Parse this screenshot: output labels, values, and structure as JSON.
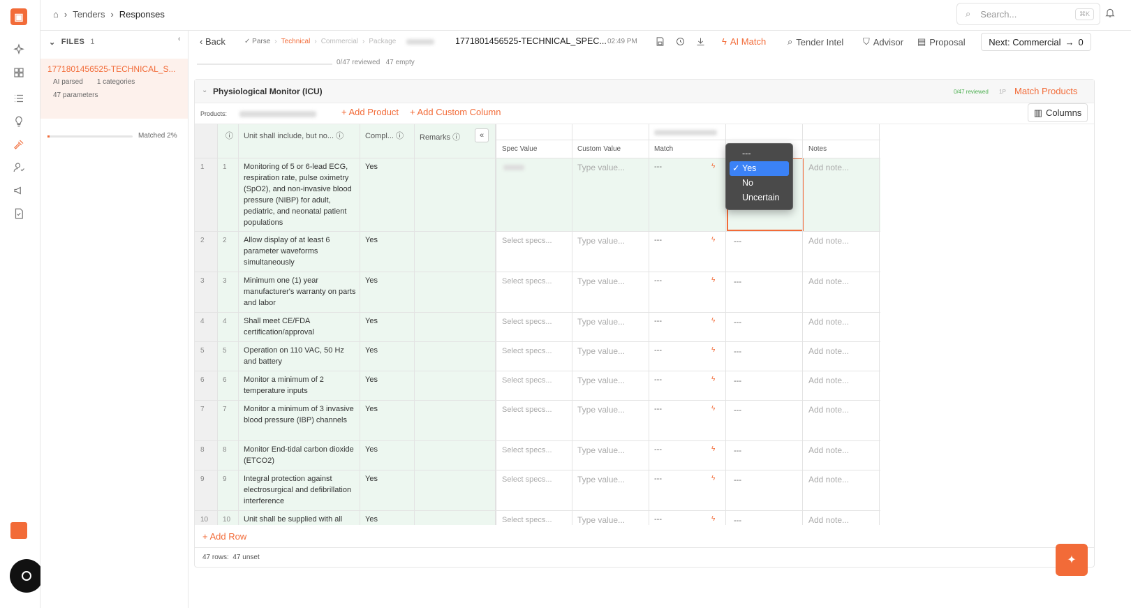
{
  "breadcrumb": {
    "item1": "Tenders",
    "item2": "Responses"
  },
  "search": {
    "placeholder": "Search...",
    "shortcut": "⌘K"
  },
  "files": {
    "title": "FILES",
    "count": "1",
    "file_name": "1771801456525-TECHNICAL_S...",
    "status": "AI parsed",
    "categories": "1 categories",
    "parameters": "47 parameters",
    "matched": "Matched 2%"
  },
  "toolbar": {
    "back": "Back",
    "steps": [
      "Parse",
      "Technical",
      "Commercial",
      "Package"
    ],
    "doc_name": "1771801456525-TECHNICAL_SPEC...",
    "time": "02:49 PM",
    "ai_match": "AI Match",
    "tender_intel": "Tender Intel",
    "advisor": "Advisor",
    "proposal": "Proposal",
    "next": "Next: Commercial",
    "next_count": "0"
  },
  "progress": {
    "reviewed": "0/47 reviewed",
    "empty": "47 empty"
  },
  "section": {
    "title": "Physiological Monitor (ICU)",
    "reviewed": "0/47 reviewed",
    "badge": "1P",
    "match_products": "Match Products",
    "products_label": "Products:",
    "add_product": "Add Product",
    "add_custom_column": "Add Custom Column",
    "columns": "Columns"
  },
  "headers": {
    "requirement": "Unit shall include, but no...",
    "compliance": "Compl...",
    "remarks": "Remarks",
    "spec_value": "Spec Value",
    "custom_value": "Custom Value",
    "match": "Match",
    "notes": "Notes"
  },
  "placeholders": {
    "select_specs": "Select specs...",
    "type_value": "Type value...",
    "add_note": "Add note...",
    "dash": "---"
  },
  "rows": [
    {
      "n": "1",
      "text": "Monitoring of 5 or 6-lead ECG, respiration rate, pulse oximetry (SpO2), and non-invasive blood pressure (NIBP) for adult, pediatric, and neonatal patient populations",
      "comp": "Yes"
    },
    {
      "n": "2",
      "text": "Allow display of at least 6 parameter waveforms simultaneously",
      "comp": "Yes"
    },
    {
      "n": "3",
      "text": "Minimum one (1) year manufacturer's warranty on parts and labor",
      "comp": "Yes"
    },
    {
      "n": "4",
      "text": "Shall meet CE/FDA certification/approval",
      "comp": "Yes"
    },
    {
      "n": "5",
      "text": "Operation on 110 VAC, 50 Hz and battery",
      "comp": "Yes"
    },
    {
      "n": "6",
      "text": "Monitor a minimum of 2 temperature inputs",
      "comp": "Yes"
    },
    {
      "n": "7",
      "text": "Monitor a minimum of 3 invasive blood pressure (IBP) channels",
      "comp": "Yes"
    },
    {
      "n": "8",
      "text": "Monitor End-tidal carbon dioxide (ETCO2)",
      "comp": "Yes"
    },
    {
      "n": "9",
      "text": "Integral protection against electrosurgical and defibrillation interference",
      "comp": "Yes"
    },
    {
      "n": "10",
      "text": "Unit shall be supplied with all",
      "comp": "Yes"
    }
  ],
  "dropdown": {
    "options": [
      "---",
      "Yes",
      "No",
      "Uncertain"
    ],
    "selected": "Yes"
  },
  "add_row": "+ Add Row",
  "footer": {
    "rows": "47 rows:",
    "unset": "47 unset"
  }
}
